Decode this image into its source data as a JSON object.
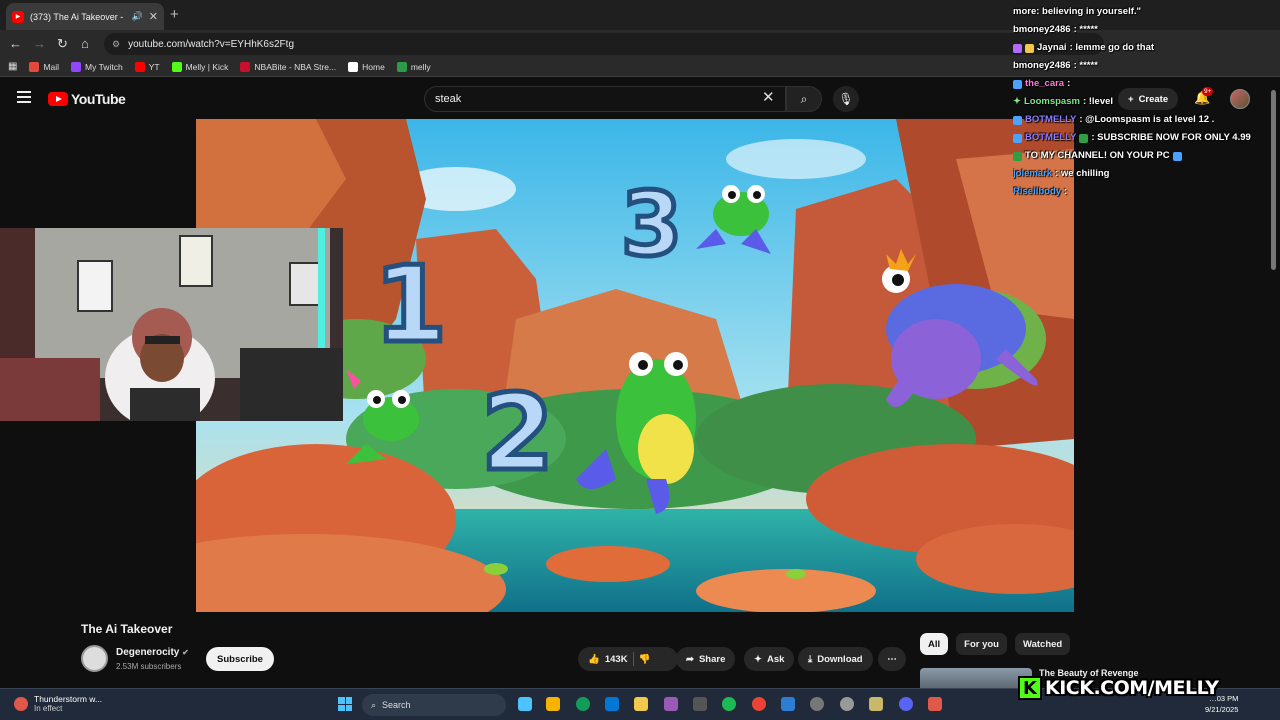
{
  "browser": {
    "tab_title": "(373) The Ai Takeover - You",
    "url": "youtube.com/watch?v=EYHhK6s2Ftg",
    "bookmarks": [
      {
        "label": "Mail",
        "color": "#e5483d"
      },
      {
        "label": "My Twitch",
        "color": "#9146ff"
      },
      {
        "label": "YT",
        "color": "#ff0000"
      },
      {
        "label": "Melly | Kick",
        "color": "#53fc18"
      },
      {
        "label": "NBABite - NBA Stre...",
        "color": "#c8102e"
      },
      {
        "label": "Home",
        "color": "#ffffff"
      },
      {
        "label": "melly",
        "color": "#2d9c4a"
      }
    ]
  },
  "youtube": {
    "logo_text": "YouTube",
    "search_value": "steak",
    "create_label": "Create",
    "notification_count": "9+"
  },
  "video_art": {
    "numbers": [
      "1",
      "2",
      "3"
    ]
  },
  "chat": [
    {
      "user": "",
      "text": "more: believing in yourself.\"",
      "color": "#ffffff"
    },
    {
      "user": "bmoney2486",
      "text": ": *****",
      "color": "#ffffff"
    },
    {
      "user": "Jaynai",
      "text": ": lemme go do that",
      "color": "#ffffff"
    },
    {
      "user": "bmoney2486",
      "text": ": *****",
      "color": "#ffffff"
    },
    {
      "user": "the_cara",
      "text": ":",
      "color": "#ff7ad9"
    },
    {
      "user": "Loomspasm",
      "text": ": !level",
      "color": "#7ee787"
    },
    {
      "user": "BOTMELLY",
      "text": ": @Loomspasm is at level 12 .",
      "color": "#8b7dff"
    },
    {
      "user": "BOTMELLY",
      "text": ": SUBSCRIBE NOW FOR ONLY 4.99",
      "color": "#8b7dff"
    },
    {
      "user": "",
      "text": "TO MY CHANNEL! ON YOUR PC",
      "color": "#ffffff"
    },
    {
      "user": "jolemark",
      "text": ": we chilling",
      "color": "#4aa3ff"
    },
    {
      "user": "Riseilbody",
      "text": ":",
      "color": "#4aa3ff"
    }
  ],
  "video_meta": {
    "title": "The Ai Takeover",
    "channel": "Degenerocity",
    "subscribers": "2.53M subscribers",
    "subscribe_label": "Subscribe",
    "likes": "143K",
    "share_label": "Share",
    "ask_label": "Ask",
    "download_label": "Download"
  },
  "sidebar": {
    "chips": [
      "All",
      "For you",
      "Watched"
    ],
    "rec_title": "The Beauty of Revenge"
  },
  "taskbar": {
    "weather_title": "Thunderstorm w...",
    "weather_sub": "In effect",
    "search_label": "Search",
    "time": "…03 PM",
    "date": "9/21/2025",
    "icons": [
      "#4cc2ff",
      "#f4b400",
      "#0f9d58",
      "#0078d4",
      "#f2c94c",
      "#9b59b6",
      "#1db954",
      "#ea4335",
      "#2d7dd2",
      "#777777",
      "#999999",
      "#c9b76a",
      "#5865f2",
      "#e0584a"
    ]
  },
  "overlay": {
    "kick_badge": "K",
    "kick_text": "KICK.COM/MELLY"
  }
}
